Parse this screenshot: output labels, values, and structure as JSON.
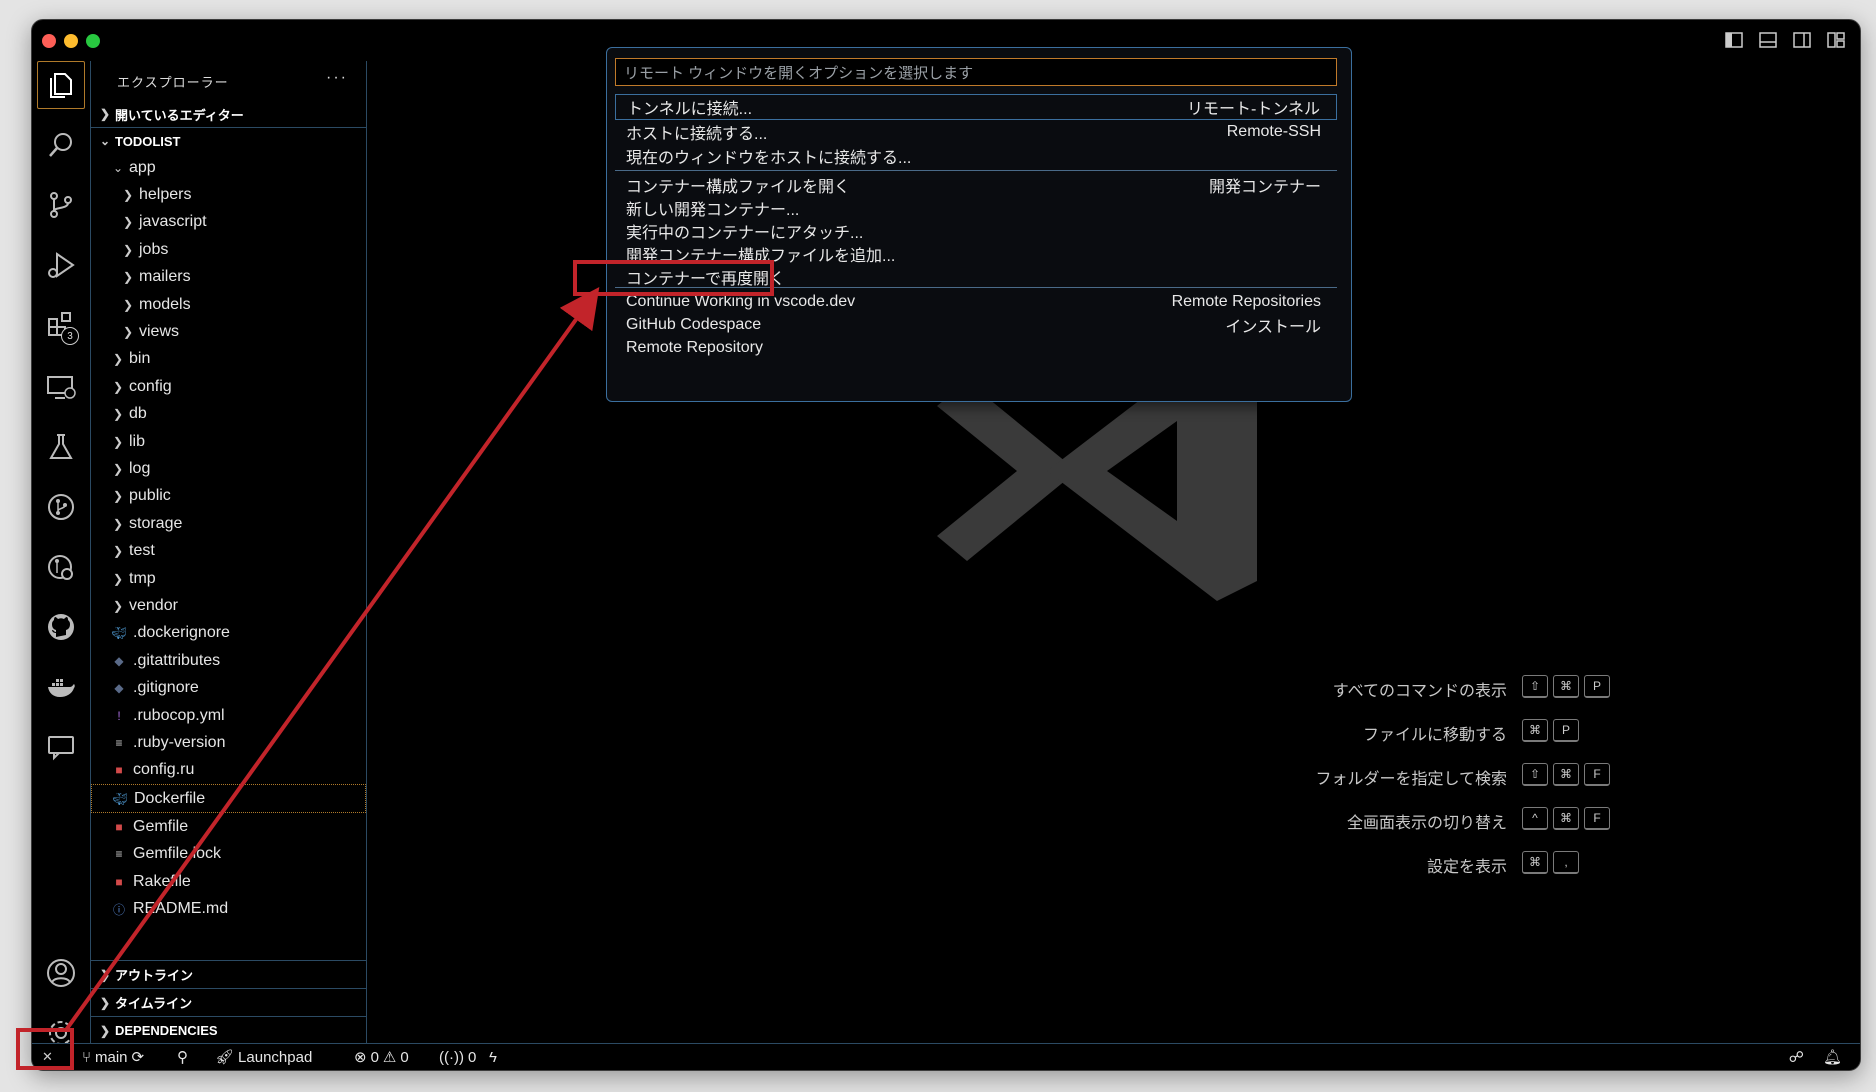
{
  "window": {
    "traffic_colors": [
      "#fe5f57",
      "#febc2e",
      "#28c840"
    ]
  },
  "activity_bar": {
    "icons": [
      "explorer-icon",
      "search-icon",
      "source-control-icon",
      "run-debug-icon",
      "extensions-icon",
      "remote-explorer-icon",
      "testing-icon",
      "git-graph-icon",
      "gitlens-icon",
      "github-icon",
      "docker-icon",
      "live-share-icon",
      "account-icon",
      "settings-icon"
    ],
    "extensions_badge": "3"
  },
  "sidebar": {
    "title": "エクスプローラー",
    "more": "···",
    "open_editors": "開いているエディター",
    "project": "TODOLIST",
    "tree": [
      {
        "label": "app",
        "kind": "folder-open",
        "indent": 1
      },
      {
        "label": "helpers",
        "kind": "folder",
        "indent": 2
      },
      {
        "label": "javascript",
        "kind": "folder",
        "indent": 2
      },
      {
        "label": "jobs",
        "kind": "folder",
        "indent": 2
      },
      {
        "label": "mailers",
        "kind": "folder",
        "indent": 2
      },
      {
        "label": "models",
        "kind": "folder",
        "indent": 2
      },
      {
        "label": "views",
        "kind": "folder",
        "indent": 2
      },
      {
        "label": "bin",
        "kind": "folder",
        "indent": 1
      },
      {
        "label": "config",
        "kind": "folder",
        "indent": 1
      },
      {
        "label": "db",
        "kind": "folder",
        "indent": 1
      },
      {
        "label": "lib",
        "kind": "folder",
        "indent": 1
      },
      {
        "label": "log",
        "kind": "folder",
        "indent": 1
      },
      {
        "label": "public",
        "kind": "folder",
        "indent": 1
      },
      {
        "label": "storage",
        "kind": "folder",
        "indent": 1
      },
      {
        "label": "test",
        "kind": "folder",
        "indent": 1
      },
      {
        "label": "tmp",
        "kind": "folder",
        "indent": 1
      },
      {
        "label": "vendor",
        "kind": "folder",
        "indent": 1
      },
      {
        "label": ".dockerignore",
        "kind": "docker",
        "indent": 1
      },
      {
        "label": ".gitattributes",
        "kind": "git",
        "indent": 1
      },
      {
        "label": ".gitignore",
        "kind": "git",
        "indent": 1
      },
      {
        "label": ".rubocop.yml",
        "kind": "yml",
        "indent": 1
      },
      {
        "label": ".ruby-version",
        "kind": "text",
        "indent": 1
      },
      {
        "label": "config.ru",
        "kind": "ruby",
        "indent": 1
      },
      {
        "label": "Dockerfile",
        "kind": "docker",
        "indent": 1,
        "selected": true
      },
      {
        "label": "Gemfile",
        "kind": "ruby",
        "indent": 1
      },
      {
        "label": "Gemfile.lock",
        "kind": "text",
        "indent": 1
      },
      {
        "label": "Rakefile",
        "kind": "ruby",
        "indent": 1
      },
      {
        "label": "README.md",
        "kind": "info",
        "indent": 1
      }
    ],
    "outline": "アウトライン",
    "timeline": "タイムライン",
    "dependencies": "DEPENDENCIES"
  },
  "quick_pick": {
    "placeholder": "リモート ウィンドウを開くオプションを選択します",
    "items": [
      {
        "label": "トンネルに接続...",
        "detail": "リモート-トンネル",
        "focused": true
      },
      {
        "label": "ホストに接続する...",
        "detail": "Remote-SSH"
      },
      {
        "label": "現在のウィンドウをホストに接続する...",
        "detail": ""
      },
      {
        "label": "コンテナー構成ファイルを開く",
        "detail": "開発コンテナー",
        "sep": true
      },
      {
        "label": "新しい開発コンテナー...",
        "detail": ""
      },
      {
        "label": "実行中のコンテナーにアタッチ...",
        "detail": ""
      },
      {
        "label": "開発コンテナー構成ファイルを追加...",
        "detail": ""
      },
      {
        "label": "コンテナーで再度開く",
        "detail": "",
        "highlight": true
      },
      {
        "label": "Continue Working in vscode.dev",
        "detail": "Remote Repositories",
        "sep": true
      },
      {
        "label": "GitHub Codespace",
        "detail": "インストール"
      },
      {
        "label": "Remote Repository",
        "detail": ""
      }
    ]
  },
  "shortcuts": [
    {
      "label": "すべてのコマンドの表示",
      "keys": [
        "⇧",
        "⌘",
        "P"
      ]
    },
    {
      "label": "ファイルに移動する",
      "keys": [
        "⌘",
        "P"
      ]
    },
    {
      "label": "フォルダーを指定して検索",
      "keys": [
        "⇧",
        "⌘",
        "F"
      ]
    },
    {
      "label": "全画面表示の切り替え",
      "keys": [
        "^",
        "⌘",
        "F"
      ]
    },
    {
      "label": "設定を表示",
      "keys": [
        "⌘",
        ","
      ]
    }
  ],
  "status_bar": {
    "remote": "✕",
    "branch": "main",
    "launchpad": "Launchpad",
    "errors": "0",
    "warnings": "0",
    "ports": "0"
  },
  "annotation": {
    "color": "#c2242a"
  }
}
